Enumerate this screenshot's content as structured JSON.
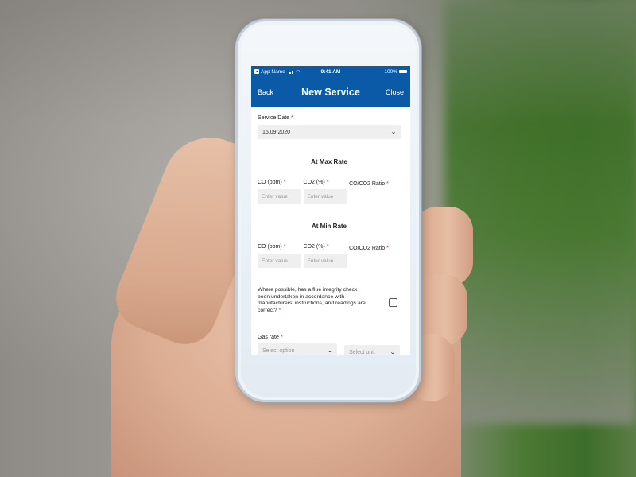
{
  "status_bar": {
    "app_name": "App Name",
    "time": "9:41 AM",
    "battery": "100%"
  },
  "nav": {
    "back_label": "Back",
    "title": "New Service",
    "close_label": "Close"
  },
  "form": {
    "service_date": {
      "label": "Service Date",
      "required_mark": "*",
      "value": "15.09.2020"
    },
    "max_rate": {
      "title": "At Max Rate",
      "fields": [
        {
          "label": "CO (ppm)",
          "required_mark": "*",
          "placeholder": "Enter value"
        },
        {
          "label": "CO2 (%)",
          "required_mark": "*",
          "placeholder": "Enter value"
        },
        {
          "label": "CO/CO2 Ratio",
          "required_mark": "*"
        }
      ]
    },
    "min_rate": {
      "title": "At Min Rate",
      "fields": [
        {
          "label": "CO (ppm)",
          "required_mark": "*",
          "placeholder": "Enter value"
        },
        {
          "label": "CO2 (%)",
          "required_mark": "*",
          "placeholder": "Enter value"
        },
        {
          "label": "CO/CO2 Ratio",
          "required_mark": "*"
        }
      ]
    },
    "flue_check": {
      "question": "Where possible, has a flue integrity check been undertaken in accordance with manufacturers' instructions, and readings are correct?",
      "required_mark": "*",
      "checked": false
    },
    "gas_rate": {
      "label": "Gas rate",
      "required_mark": "*",
      "option_placeholder": "Select option",
      "unit_placeholder": "Select unit"
    }
  },
  "colors": {
    "brand_blue": "#0b5aa8",
    "required_red": "#e02020"
  }
}
